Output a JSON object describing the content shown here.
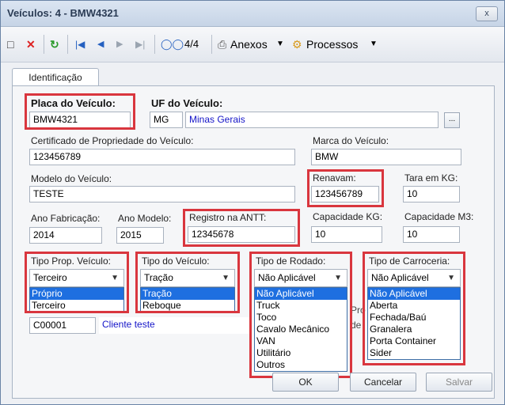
{
  "window": {
    "title": "Veículos: 4 - BMW4321",
    "close_label": "x"
  },
  "toolbar": {
    "record_counter": "4/4",
    "attachments_label": "Anexos",
    "processes_label": "Processos"
  },
  "tabs": [
    {
      "label": "Identificação"
    }
  ],
  "form": {
    "placa_label": "Placa do Veículo:",
    "placa_value": "BMW4321",
    "uf_label": "UF do Veículo:",
    "uf_code": "MG",
    "uf_name": "Minas Gerais",
    "lookup_button": "...",
    "certificado_label": "Certificado de Propriedade do Veículo:",
    "certificado_value": "123456789",
    "marca_label": "Marca do Veículo:",
    "marca_value": "BMW",
    "modelo_label": "Modelo do Veículo:",
    "modelo_value": "TESTE",
    "renavam_label": "Renavam:",
    "renavam_value": "123456789",
    "tara_label": "Tara em KG:",
    "tara_value": "10",
    "ano_fab_label": "Ano Fabricação:",
    "ano_fab_value": "2014",
    "ano_modelo_label": "Ano Modelo:",
    "ano_modelo_value": "2015",
    "antt_label": "Registro na ANTT:",
    "antt_value": "12345678",
    "cap_kg_label": "Capacidade KG:",
    "cap_kg_value": "10",
    "cap_m3_label": "Capacidade M3:",
    "cap_m3_value": "10",
    "prop_label": "Tipo Prop. Veículo:",
    "prop_selected": "Terceiro",
    "prop_options": [
      "Próprio",
      "Terceiro"
    ],
    "tipo_label": "Tipo do Veículo:",
    "tipo_selected": "Tração",
    "tipo_options": [
      "Tração",
      "Reboque"
    ],
    "rodado_label": "Tipo de Rodado:",
    "rodado_selected": "Não Aplicável",
    "rodado_options": [
      "Não Aplicável",
      "Truck",
      "Toco",
      "Cavalo Mecânico",
      "VAN",
      "Utilitário",
      "Outros"
    ],
    "carroceria_label": "Tipo de Carroceria:",
    "carroceria_selected": "Não Aplicável",
    "carroceria_options": [
      "Não Aplicável",
      "Aberta",
      "Fechada/Baú",
      "Granalera",
      "Porta Container",
      "Sider"
    ],
    "cliente_code": "C00001",
    "cliente_name": "Cliente  teste",
    "hidden_fragment_1": "Pro",
    "hidden_fragment_2": "de"
  },
  "buttons": {
    "ok": "OK",
    "cancel": "Cancelar",
    "save": "Salvar"
  },
  "colors": {
    "highlight": "#d9363e",
    "selection": "#1e6fe0",
    "link_text": "#1414c8"
  }
}
